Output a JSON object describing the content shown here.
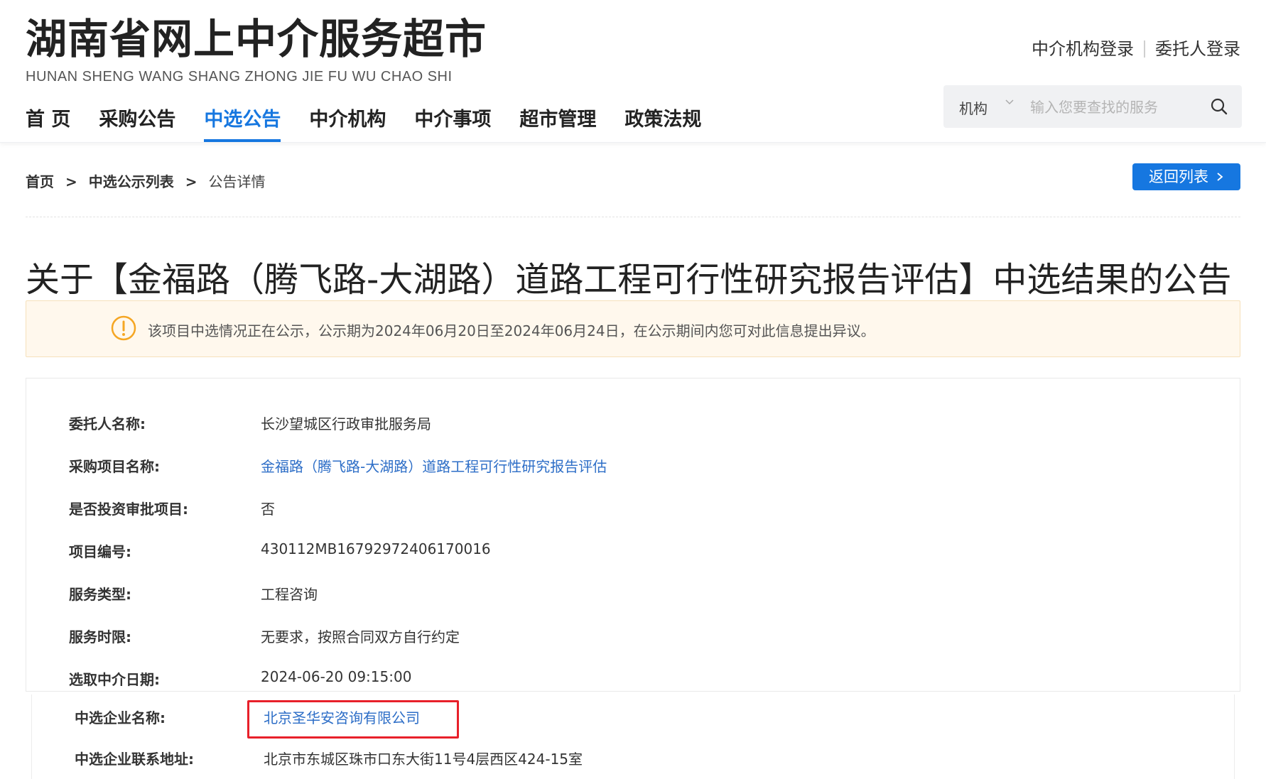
{
  "site": {
    "title": "湖南省网上中介服务超市",
    "subtitle": "HUNAN SHENG WANG SHANG ZHONG JIE FU WU CHAO SHI"
  },
  "top_links": {
    "agency_login": "中介机构登录",
    "client_login": "委托人登录"
  },
  "nav": {
    "items": [
      "首 页",
      "采购公告",
      "中选公告",
      "中介机构",
      "中介事项",
      "超市管理",
      "政策法规"
    ],
    "active": "中选公告"
  },
  "search": {
    "category": "机构",
    "placeholder": "输入您要查找的服务",
    "icon": "search-icon"
  },
  "breadcrumb": {
    "home": "首页",
    "list": "中选公示列表",
    "current": "公告详情",
    "separator": ">"
  },
  "back_button": {
    "label": "返回列表",
    "icon": "chevron-right-icon"
  },
  "page_title": "关于【金福路（腾飞路-大湖路）道路工程可行性研究报告评估】中选结果的公告",
  "notice": {
    "icon": "warning-circle-icon",
    "text": "该项目中选情况正在公示，公示期为2024年06月20日至2024年06月24日，在公示期间内您可对此信息提出异议。",
    "color": "#f5a623"
  },
  "details": [
    {
      "label": "委托人名称:",
      "value": "长沙望城区行政审批服务局"
    },
    {
      "label": "采购项目名称:",
      "value": "金福路（腾飞路-大湖路）道路工程可行性研究报告评估"
    },
    {
      "label": "是否投资审批项目:",
      "value": "否"
    },
    {
      "label": "项目编号:",
      "value": "430112MB16792972406170016"
    },
    {
      "label": "服务类型:",
      "value": "工程咨询"
    },
    {
      "label": "服务时限:",
      "value": "无要求，按照合同双方自行约定"
    },
    {
      "label": "选取中介日期:",
      "value": "2024-06-20 09:15:00"
    }
  ],
  "winner": {
    "name_label": "中选企业名称:",
    "name_value": "北京圣华安咨询有限公司",
    "address_label": "中选企业联系地址:",
    "address_value": "北京市东城区珠市口东大街11号4层西区424-15室"
  },
  "colors": {
    "primary": "#1677e0",
    "link": "#2d6ec7",
    "highlight": "#e8202a",
    "notice_bg": "#fff8ed"
  }
}
